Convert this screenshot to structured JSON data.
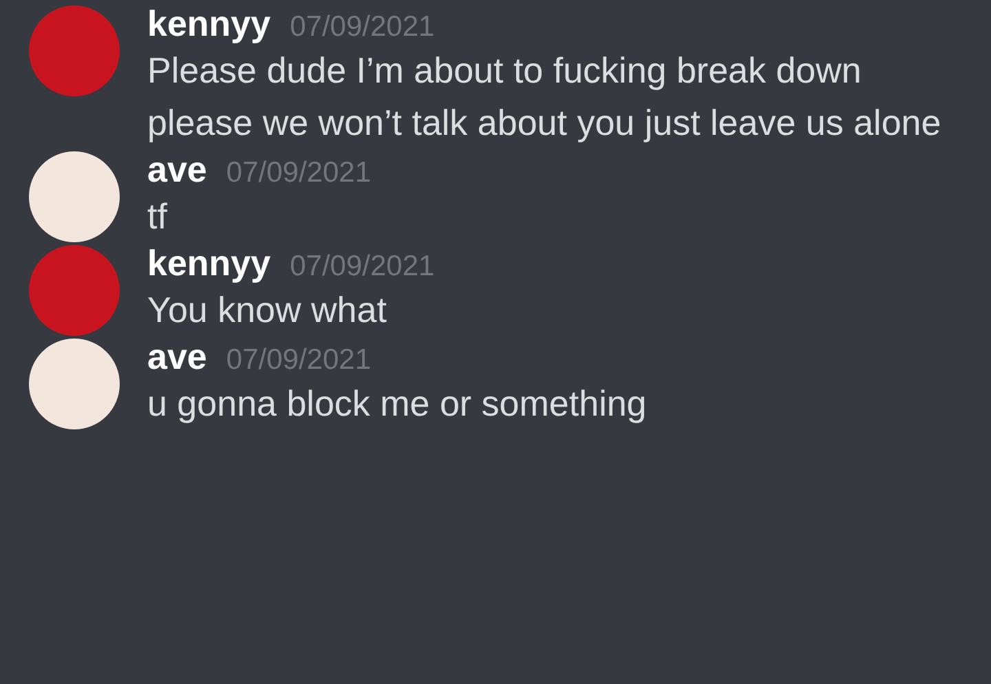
{
  "messages": [
    {
      "author": "kennyy",
      "timestamp": "07/09/2021",
      "text": "Please dude I’m about to fucking break down please we won’t talk about you just leave us alone",
      "color": "#c8141e"
    },
    {
      "author": "ave",
      "timestamp": "07/09/2021",
      "text": "tf",
      "color": "#f3e6dc"
    },
    {
      "author": "kennyy",
      "timestamp": "07/09/2021",
      "text": "You know what",
      "color": "#c8141e"
    },
    {
      "author": "ave",
      "timestamp": "07/09/2021",
      "text": "u gonna block me or something",
      "color": "#f3e6dc"
    }
  ]
}
